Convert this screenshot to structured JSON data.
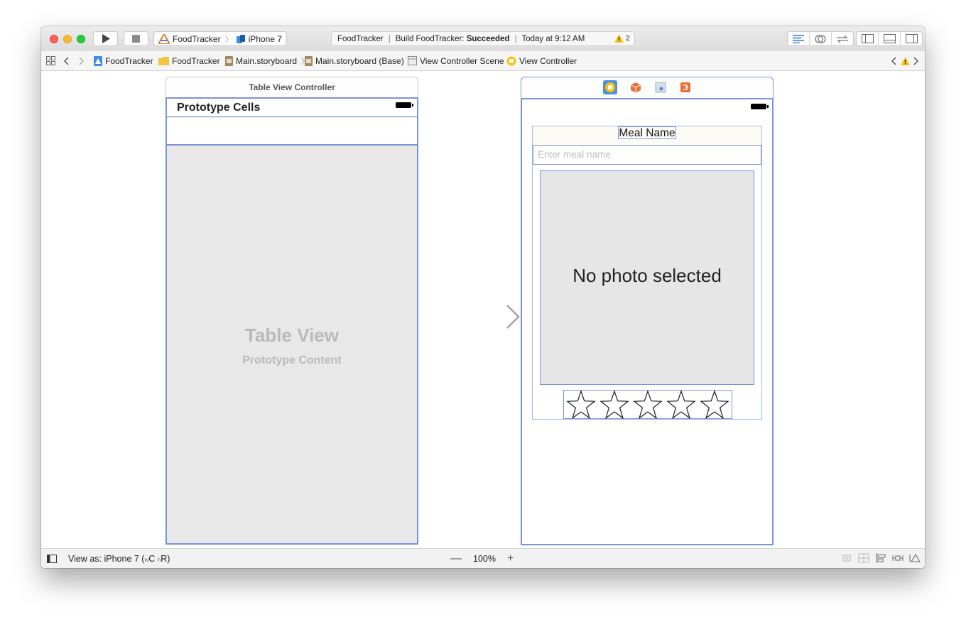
{
  "toolbar": {
    "scheme_app": "FoodTracker",
    "scheme_device": "iPhone 7",
    "activity_app": "FoodTracker",
    "activity_build_prefix": "Build FoodTracker:",
    "activity_build_status": "Succeeded",
    "activity_time": "Today at 9:12 AM",
    "warning_count": "2"
  },
  "jumpbar": {
    "crumbs": [
      "FoodTracker",
      "FoodTracker",
      "Main.storyboard",
      "Main.storyboard (Base)",
      "View Controller Scene",
      "View Controller"
    ]
  },
  "scene1": {
    "title": "Table View Controller",
    "prototype_header": "Prototype Cells",
    "table_view_title": "Table View",
    "table_view_subtitle": "Prototype Content"
  },
  "scene2": {
    "meal_label": "Meal Name",
    "meal_placeholder": "Enter meal name",
    "photo_text": "No photo selected",
    "rating_stars": 5
  },
  "bottombar": {
    "view_as_prefix": "View as: iPhone 7 (",
    "width_class_prefix": "w",
    "width_class": "C",
    "height_class_prefix": "h",
    "height_class": "R",
    "view_as_suffix": ")",
    "zoom_level": "100%"
  },
  "colors": {
    "selection_blue": "#7b93d9",
    "canvas_gray": "#e8e8e8",
    "warning_yellow": "#f5c518",
    "vc_icon_yellow": "#ffc107",
    "accent_orange": "#e8703a"
  }
}
